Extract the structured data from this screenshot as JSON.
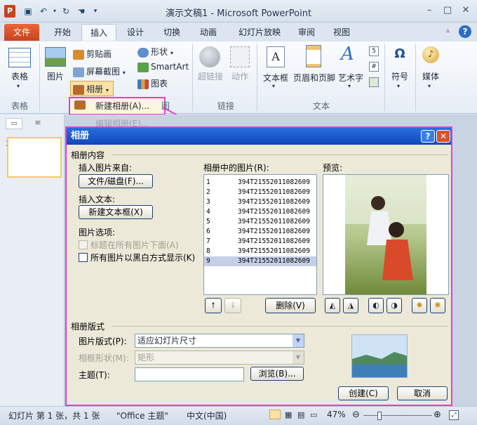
{
  "window": {
    "title": "演示文稿1 - Microsoft PowerPoint",
    "logo_letter": "P"
  },
  "quick_access": {
    "save": "保存",
    "undo": "撤消",
    "redo": "重复"
  },
  "ribbon_tabs": [
    "文件",
    "开始",
    "插入",
    "设计",
    "切换",
    "动画",
    "幻灯片放映",
    "审阅",
    "视图"
  ],
  "ribbon": {
    "table": "表格",
    "picture": "图片",
    "clipart": "剪贴画",
    "screenshot": "屏幕截图",
    "album": "相册",
    "shapes": "形状",
    "smartart": "SmartArt",
    "chart": "图表",
    "hyperlink": "超链接",
    "action": "动作",
    "textbox": "文本框",
    "header_footer": "页眉和页脚",
    "wordart": "艺术字",
    "symbol": "符号",
    "media": "媒体",
    "groups": {
      "tables": "表格",
      "images": "图",
      "links": "链接",
      "text": "文本"
    }
  },
  "album_menu": {
    "new_album": "新建相册(A)...",
    "edit_album": "编辑相册(E)..."
  },
  "slides_panel": {
    "slide_number": "1"
  },
  "dialog": {
    "title": "相册",
    "help": "?",
    "close": "✕",
    "section_content": "相册内容",
    "insert_from_label": "插入图片来自:",
    "file_disk_button": "文件/磁盘(F)...",
    "insert_text_label": "插入文本:",
    "new_textbox_button": "新建文本框(X)",
    "picture_options_label": "图片选项:",
    "caption_below": "标题在所有图片下面(A)",
    "all_black_white": "所有图片以黑白方式显示(K)",
    "pictures_in_album_label": "相册中的图片(R):",
    "pictures": [
      {
        "num": "1",
        "file": "394T21552011082609"
      },
      {
        "num": "2",
        "file": "394T21552011082609"
      },
      {
        "num": "3",
        "file": "394T21552011082609"
      },
      {
        "num": "4",
        "file": "394T21552011082609"
      },
      {
        "num": "5",
        "file": "394T21552011082609"
      },
      {
        "num": "6",
        "file": "394T21552011082609"
      },
      {
        "num": "7",
        "file": "394T21552011082609"
      },
      {
        "num": "8",
        "file": "394T21552011082609"
      },
      {
        "num": "9",
        "file": "394T21552011082609"
      }
    ],
    "selected_index": 9,
    "delete_button": "删除(V)",
    "preview_label": "预览:",
    "section_layout": "相册版式",
    "picture_layout_label": "图片版式(P):",
    "picture_layout_value": "适应幻灯片尺寸",
    "frame_shape_label": "相框形状(M):",
    "frame_shape_value": "矩形",
    "theme_label": "主题(T):",
    "theme_value": "",
    "browse_button": "浏览(B)...",
    "create_button": "创建(C)",
    "cancel_button": "取消"
  },
  "statusbar": {
    "slide_info": "幻灯片 第 1 张，共 1 张",
    "theme": "\"Office 主题\"",
    "language": "中文(中国)",
    "zoom": "47%",
    "zoom_fraction": 0.47
  }
}
